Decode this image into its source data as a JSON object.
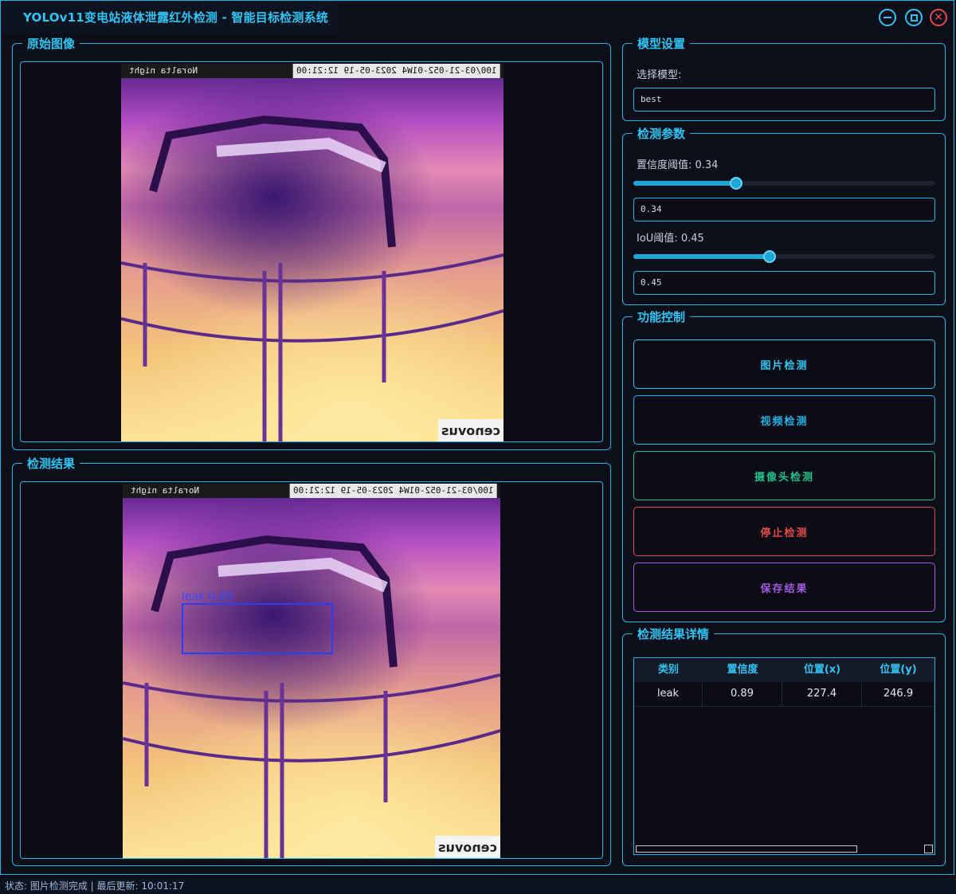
{
  "window": {
    "title": "YOLOv11变电站液体泄露红外检测 - 智能目标检测系统",
    "controls": [
      "minimize-icon",
      "maximize-icon",
      "close-icon"
    ],
    "accent_color": "#2fc4f2"
  },
  "original_panel": {
    "title": "原始图像",
    "image": {
      "banner_left": "Noralta night",
      "banner_right": "100/03-21-052-01W4 2023-05-19 12:21:00",
      "logo": "cenovus"
    }
  },
  "result_panel": {
    "title": "检测结果",
    "image": {
      "banner_left": "Noralta night",
      "banner_right": "100/03-21-052-01W4 2023-05-19 12:21:00",
      "logo": "cenovus"
    },
    "detection_label": "leak 0.89"
  },
  "model_settings": {
    "title": "模型设置",
    "select_label": "选择模型:",
    "model_value": "best"
  },
  "detection_params": {
    "title": "检测参数",
    "conf_label": "置信度阈值: 0.34",
    "conf_value": "0.34",
    "conf_fraction": 0.34,
    "iou_label": "IoU阈值: 0.45",
    "iou_value": "0.45",
    "iou_fraction": 0.45
  },
  "controls": {
    "title": "功能控制",
    "image_detect": "图片检测",
    "video_detect": "视频检测",
    "camera_detect": "摄像头检测",
    "stop_detect": "停止检测",
    "save_results": "保存结果",
    "colors": {
      "image": "#2fc4f2",
      "video": "#1fb3e6",
      "camera": "#22c08a",
      "stop": "#e14b4b",
      "save": "#a35ae0"
    }
  },
  "results_table": {
    "title": "检测结果详情",
    "headers": [
      "类别",
      "置信度",
      "位置(x)",
      "位置(y)"
    ],
    "rows": [
      {
        "class": "leak",
        "confidence": "0.89",
        "x": "227.4",
        "y": "246.9"
      }
    ]
  },
  "status_bar": {
    "text": "状态: 图片检测完成 | 最后更新: 10:01:17"
  }
}
